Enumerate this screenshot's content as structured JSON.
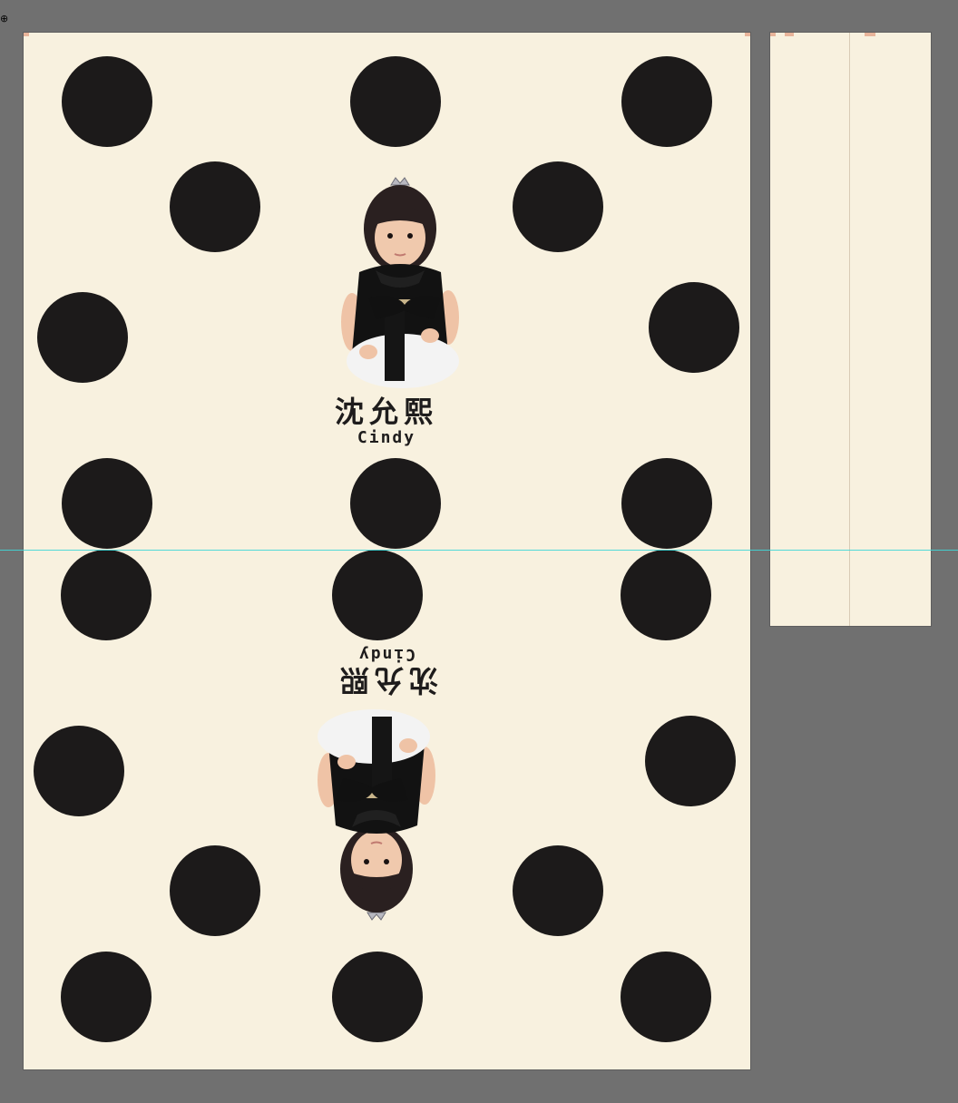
{
  "canvas": {
    "background_color": "#707070",
    "artboard_color": "#f8f1df",
    "dot_color": "#1c1a1a",
    "guide_color": "#3fd7d7"
  },
  "label_top": {
    "name_cn": "沈允熙",
    "name_en": "Cindy"
  },
  "label_bottom": {
    "name_cn": "沈允熙",
    "name_en": "Cindy"
  },
  "icons": {
    "cursor": "move-cursor-icon",
    "portrait": "child-portrait-photo"
  }
}
